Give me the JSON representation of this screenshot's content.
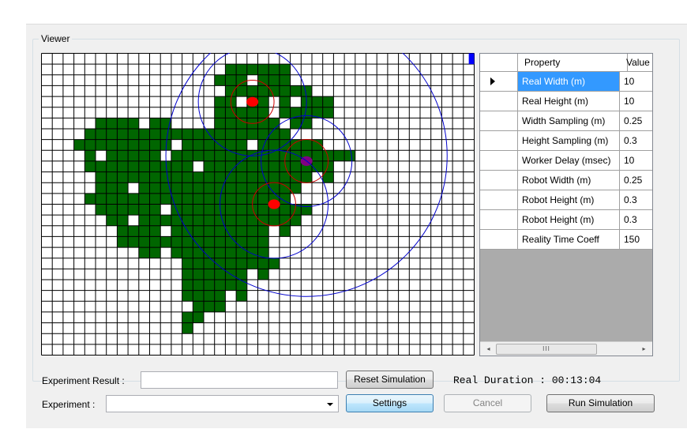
{
  "viewer": {
    "title": "Viewer",
    "grid": {
      "cols": 40,
      "rows": 28,
      "cell_color": "#006600",
      "line_color": "#000000",
      "filled": [
        [
          1,
          17
        ],
        [
          1,
          18
        ],
        [
          1,
          19
        ],
        [
          1,
          20
        ],
        [
          1,
          21
        ],
        [
          1,
          22
        ],
        [
          2,
          16
        ],
        [
          2,
          17
        ],
        [
          2,
          18
        ],
        [
          2,
          20
        ],
        [
          2,
          21
        ],
        [
          2,
          22
        ],
        [
          3,
          17
        ],
        [
          3,
          18
        ],
        [
          3,
          19
        ],
        [
          3,
          20
        ],
        [
          3,
          21
        ],
        [
          3,
          22
        ],
        [
          3,
          23
        ],
        [
          3,
          24
        ],
        [
          4,
          16
        ],
        [
          4,
          17
        ],
        [
          4,
          19
        ],
        [
          4,
          20
        ],
        [
          4,
          22
        ],
        [
          4,
          24
        ],
        [
          4,
          25
        ],
        [
          4,
          26
        ],
        [
          5,
          16
        ],
        [
          5,
          17
        ],
        [
          5,
          18
        ],
        [
          5,
          19
        ],
        [
          5,
          20
        ],
        [
          5,
          22
        ],
        [
          5,
          23
        ],
        [
          5,
          24
        ],
        [
          5,
          25
        ],
        [
          5,
          26
        ],
        [
          6,
          5
        ],
        [
          6,
          6
        ],
        [
          6,
          7
        ],
        [
          6,
          8
        ],
        [
          6,
          10
        ],
        [
          6,
          11
        ],
        [
          6,
          16
        ],
        [
          6,
          17
        ],
        [
          6,
          18
        ],
        [
          6,
          19
        ],
        [
          6,
          20
        ],
        [
          6,
          21
        ],
        [
          6,
          23
        ],
        [
          6,
          24
        ],
        [
          7,
          4
        ],
        [
          7,
          5
        ],
        [
          7,
          6
        ],
        [
          7,
          7
        ],
        [
          7,
          8
        ],
        [
          7,
          9
        ],
        [
          7,
          10
        ],
        [
          7,
          11
        ],
        [
          7,
          12
        ],
        [
          7,
          13
        ],
        [
          7,
          14
        ],
        [
          7,
          15
        ],
        [
          7,
          16
        ],
        [
          7,
          17
        ],
        [
          7,
          18
        ],
        [
          7,
          19
        ],
        [
          7,
          20
        ],
        [
          7,
          21
        ],
        [
          7,
          22
        ],
        [
          8,
          3
        ],
        [
          8,
          4
        ],
        [
          8,
          5
        ],
        [
          8,
          6
        ],
        [
          8,
          7
        ],
        [
          8,
          8
        ],
        [
          8,
          9
        ],
        [
          8,
          10
        ],
        [
          8,
          11
        ],
        [
          8,
          13
        ],
        [
          8,
          14
        ],
        [
          8,
          15
        ],
        [
          8,
          16
        ],
        [
          8,
          17
        ],
        [
          8,
          18
        ],
        [
          8,
          20
        ],
        [
          8,
          21
        ],
        [
          8,
          22
        ],
        [
          8,
          23
        ],
        [
          8,
          24
        ],
        [
          8,
          25
        ],
        [
          9,
          4
        ],
        [
          9,
          6
        ],
        [
          9,
          7
        ],
        [
          9,
          8
        ],
        [
          9,
          9
        ],
        [
          9,
          10
        ],
        [
          9,
          12
        ],
        [
          9,
          13
        ],
        [
          9,
          14
        ],
        [
          9,
          15
        ],
        [
          9,
          16
        ],
        [
          9,
          17
        ],
        [
          9,
          18
        ],
        [
          9,
          19
        ],
        [
          9,
          20
        ],
        [
          9,
          21
        ],
        [
          9,
          22
        ],
        [
          9,
          23
        ],
        [
          9,
          24
        ],
        [
          9,
          25
        ],
        [
          9,
          26
        ],
        [
          9,
          27
        ],
        [
          9,
          28
        ],
        [
          10,
          4
        ],
        [
          10,
          5
        ],
        [
          10,
          6
        ],
        [
          10,
          7
        ],
        [
          10,
          8
        ],
        [
          10,
          9
        ],
        [
          10,
          10
        ],
        [
          10,
          11
        ],
        [
          10,
          12
        ],
        [
          10,
          13
        ],
        [
          10,
          15
        ],
        [
          10,
          16
        ],
        [
          10,
          17
        ],
        [
          10,
          18
        ],
        [
          10,
          19
        ],
        [
          10,
          20
        ],
        [
          10,
          21
        ],
        [
          10,
          22
        ],
        [
          10,
          23
        ],
        [
          10,
          24
        ],
        [
          10,
          25
        ],
        [
          10,
          26
        ],
        [
          11,
          5
        ],
        [
          11,
          6
        ],
        [
          11,
          7
        ],
        [
          11,
          8
        ],
        [
          11,
          9
        ],
        [
          11,
          10
        ],
        [
          11,
          11
        ],
        [
          11,
          12
        ],
        [
          11,
          13
        ],
        [
          11,
          14
        ],
        [
          11,
          15
        ],
        [
          11,
          16
        ],
        [
          11,
          17
        ],
        [
          11,
          18
        ],
        [
          11,
          19
        ],
        [
          11,
          20
        ],
        [
          11,
          21
        ],
        [
          11,
          22
        ],
        [
          11,
          23
        ],
        [
          11,
          24
        ],
        [
          11,
          26
        ],
        [
          12,
          5
        ],
        [
          12,
          6
        ],
        [
          12,
          7
        ],
        [
          12,
          9
        ],
        [
          12,
          10
        ],
        [
          12,
          11
        ],
        [
          12,
          12
        ],
        [
          12,
          13
        ],
        [
          12,
          14
        ],
        [
          12,
          15
        ],
        [
          12,
          16
        ],
        [
          12,
          17
        ],
        [
          12,
          18
        ],
        [
          12,
          19
        ],
        [
          12,
          20
        ],
        [
          12,
          21
        ],
        [
          12,
          22
        ],
        [
          12,
          23
        ],
        [
          13,
          4
        ],
        [
          13,
          5
        ],
        [
          13,
          6
        ],
        [
          13,
          7
        ],
        [
          13,
          8
        ],
        [
          13,
          9
        ],
        [
          13,
          10
        ],
        [
          13,
          11
        ],
        [
          13,
          12
        ],
        [
          13,
          13
        ],
        [
          13,
          14
        ],
        [
          13,
          15
        ],
        [
          13,
          16
        ],
        [
          13,
          17
        ],
        [
          13,
          18
        ],
        [
          13,
          19
        ],
        [
          13,
          20
        ],
        [
          13,
          21
        ],
        [
          13,
          22
        ],
        [
          14,
          5
        ],
        [
          14,
          6
        ],
        [
          14,
          7
        ],
        [
          14,
          8
        ],
        [
          14,
          9
        ],
        [
          14,
          10
        ],
        [
          14,
          12
        ],
        [
          14,
          13
        ],
        [
          14,
          14
        ],
        [
          14,
          15
        ],
        [
          14,
          16
        ],
        [
          14,
          17
        ],
        [
          14,
          18
        ],
        [
          14,
          19
        ],
        [
          14,
          20
        ],
        [
          14,
          21
        ],
        [
          14,
          22
        ],
        [
          14,
          23
        ],
        [
          14,
          24
        ],
        [
          15,
          6
        ],
        [
          15,
          7
        ],
        [
          15,
          9
        ],
        [
          15,
          10
        ],
        [
          15,
          11
        ],
        [
          15,
          12
        ],
        [
          15,
          13
        ],
        [
          15,
          14
        ],
        [
          15,
          15
        ],
        [
          15,
          16
        ],
        [
          15,
          17
        ],
        [
          15,
          18
        ],
        [
          15,
          19
        ],
        [
          15,
          20
        ],
        [
          15,
          21
        ],
        [
          15,
          22
        ],
        [
          15,
          23
        ],
        [
          16,
          7
        ],
        [
          16,
          8
        ],
        [
          16,
          9
        ],
        [
          16,
          10
        ],
        [
          16,
          12
        ],
        [
          16,
          13
        ],
        [
          16,
          14
        ],
        [
          16,
          15
        ],
        [
          16,
          16
        ],
        [
          16,
          17
        ],
        [
          16,
          18
        ],
        [
          16,
          19
        ],
        [
          16,
          20
        ],
        [
          16,
          22
        ],
        [
          17,
          7
        ],
        [
          17,
          8
        ],
        [
          17,
          9
        ],
        [
          17,
          10
        ],
        [
          17,
          11
        ],
        [
          17,
          12
        ],
        [
          17,
          13
        ],
        [
          17,
          14
        ],
        [
          17,
          15
        ],
        [
          17,
          16
        ],
        [
          17,
          17
        ],
        [
          17,
          18
        ],
        [
          17,
          19
        ],
        [
          17,
          20
        ],
        [
          18,
          9
        ],
        [
          18,
          10
        ],
        [
          18,
          12
        ],
        [
          18,
          13
        ],
        [
          18,
          14
        ],
        [
          18,
          15
        ],
        [
          18,
          16
        ],
        [
          18,
          17
        ],
        [
          18,
          18
        ],
        [
          18,
          19
        ],
        [
          18,
          20
        ],
        [
          19,
          13
        ],
        [
          19,
          14
        ],
        [
          19,
          15
        ],
        [
          19,
          16
        ],
        [
          19,
          17
        ],
        [
          19,
          18
        ],
        [
          19,
          19
        ],
        [
          19,
          20
        ],
        [
          19,
          21
        ],
        [
          20,
          13
        ],
        [
          20,
          14
        ],
        [
          20,
          15
        ],
        [
          20,
          16
        ],
        [
          20,
          17
        ],
        [
          20,
          18
        ],
        [
          20,
          20
        ],
        [
          21,
          13
        ],
        [
          21,
          14
        ],
        [
          21,
          15
        ],
        [
          21,
          16
        ],
        [
          21,
          17
        ],
        [
          21,
          18
        ],
        [
          22,
          13
        ],
        [
          22,
          14
        ],
        [
          22,
          15
        ],
        [
          22,
          16
        ],
        [
          22,
          18
        ],
        [
          23,
          14
        ],
        [
          23,
          15
        ],
        [
          23,
          16
        ],
        [
          24,
          13
        ],
        [
          24,
          14
        ],
        [
          25,
          13
        ]
      ],
      "corner_marker_color": "#0000ff"
    },
    "robots": [
      {
        "name": "red-robot",
        "color": "#ff0000",
        "col": 19.5,
        "row": 4.5,
        "sense": 2.0,
        "comm": 5.0
      },
      {
        "name": "purple-robot",
        "color": "#800080",
        "col": 24.5,
        "row": 10.0,
        "sense": 2.0,
        "comm": 4.2
      },
      {
        "name": "red-robot-2",
        "color": "#ff0000",
        "col": 21.5,
        "row": 14.0,
        "sense": 2.0,
        "comm": 5.0
      }
    ],
    "big_circle": {
      "col": 24.5,
      "row": 9.5,
      "r": 13.0,
      "color": "#0000cc"
    },
    "sense_color": "#cc0000",
    "comm_color": "#0000cc"
  },
  "property_grid": {
    "headers": {
      "property": "Property",
      "value": "Value"
    },
    "rows": [
      {
        "property": "Real Width (m)",
        "value": "10",
        "selected": true
      },
      {
        "property": "Real Height (m)",
        "value": "10"
      },
      {
        "property": "Width Sampling (m)",
        "value": "0.25"
      },
      {
        "property": "Height Sampling (m)",
        "value": "0.3"
      },
      {
        "property": "Worker Delay (msec)",
        "value": "10"
      },
      {
        "property": "Robot Width (m)",
        "value": "0.25"
      },
      {
        "property": "Robot Height (m)",
        "value": "0.3"
      },
      {
        "property": "Robot Height (m)",
        "value": "0.3"
      },
      {
        "property": "Reality Time Coeff",
        "value": "150"
      }
    ],
    "scrollbar": {
      "left_glyph": "◂",
      "right_glyph": "▸",
      "thumb_glyph": "III"
    }
  },
  "controls": {
    "experiment_result_label": "Experiment Result :",
    "experiment_result_value": "",
    "reset_button": "Reset Simulation",
    "duration_label": "Real Duration : 00:13:04",
    "experiment_label": "Experiment :",
    "experiment_value": "",
    "settings_button": "Settings",
    "cancel_button": "Cancel",
    "run_button": "Run Simulation"
  }
}
